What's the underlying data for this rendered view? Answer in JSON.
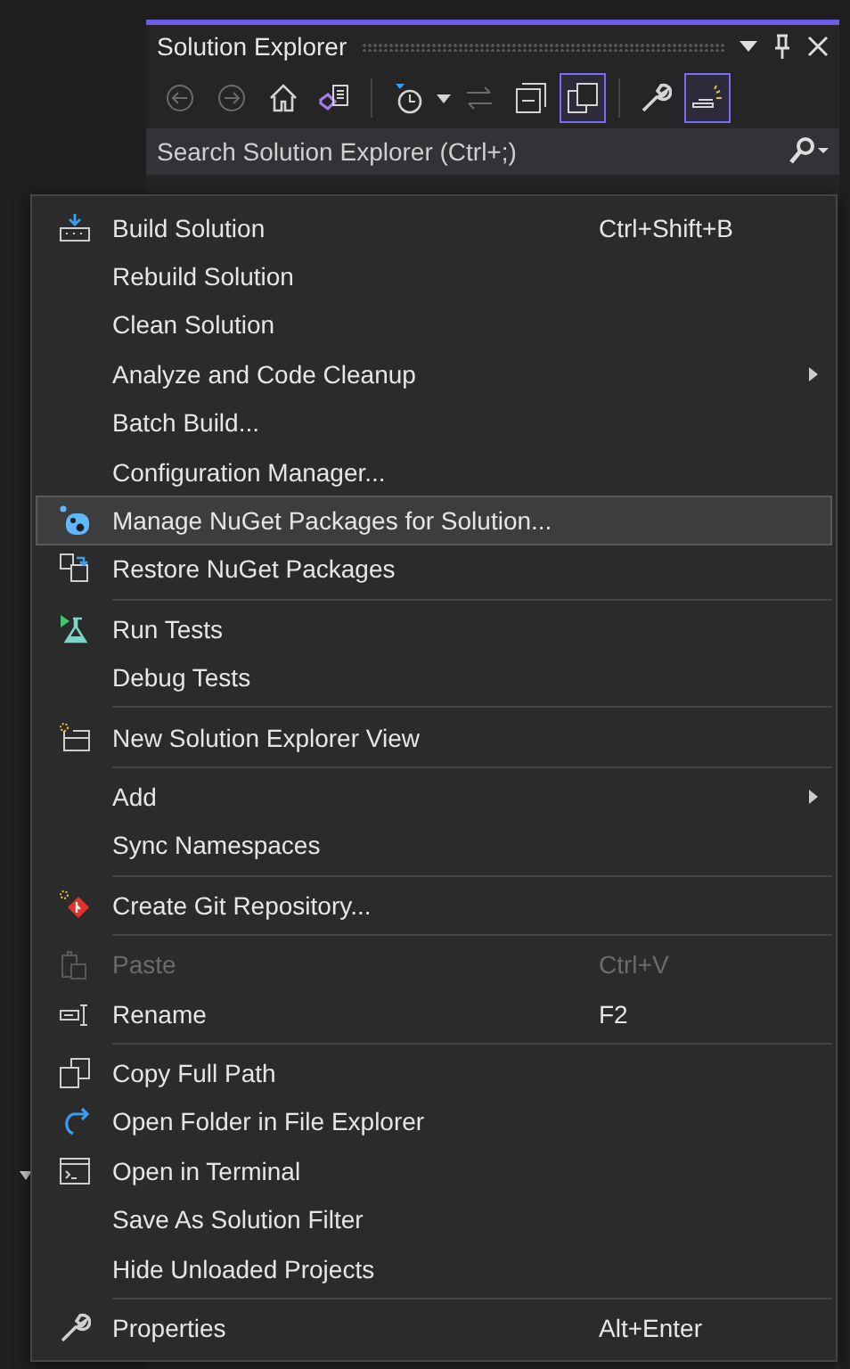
{
  "panel": {
    "title": "Solution Explorer",
    "search": {
      "placeholder": "Search Solution Explorer (Ctrl+;)"
    },
    "toolbar": [
      {
        "kind": "button",
        "disabled": true,
        "selected": false
      },
      {
        "kind": "button",
        "disabled": true,
        "selected": false
      },
      {
        "kind": "button",
        "disabled": false,
        "selected": false
      },
      {
        "kind": "button",
        "disabled": false,
        "selected": false
      },
      {
        "kind": "divider"
      },
      {
        "kind": "button",
        "disabled": false,
        "selected": false
      },
      {
        "kind": "dropdown"
      },
      {
        "kind": "button",
        "disabled": true,
        "selected": false
      },
      {
        "kind": "button",
        "disabled": false,
        "selected": false
      },
      {
        "kind": "button",
        "disabled": false,
        "selected": true
      },
      {
        "kind": "divider"
      },
      {
        "kind": "button",
        "disabled": false,
        "selected": false
      },
      {
        "kind": "button",
        "disabled": false,
        "selected": true
      }
    ]
  },
  "menu": [
    {
      "kind": "item",
      "label": "Build Solution",
      "shortcut": "Ctrl+Shift+B",
      "disabled": false,
      "selected": false,
      "submenu": false
    },
    {
      "kind": "item",
      "label": "Rebuild Solution",
      "disabled": false,
      "selected": false,
      "submenu": false
    },
    {
      "kind": "item",
      "label": "Clean Solution",
      "disabled": false,
      "selected": false,
      "submenu": false
    },
    {
      "kind": "item",
      "label": "Analyze and Code Cleanup",
      "disabled": false,
      "selected": false,
      "submenu": true
    },
    {
      "kind": "item",
      "label": "Batch Build...",
      "disabled": false,
      "selected": false,
      "submenu": false
    },
    {
      "kind": "item",
      "label": "Configuration Manager...",
      "disabled": false,
      "selected": false,
      "submenu": false
    },
    {
      "kind": "item",
      "label": "Manage NuGet Packages for Solution...",
      "disabled": false,
      "selected": true,
      "submenu": false
    },
    {
      "kind": "item",
      "label": "Restore NuGet Packages",
      "disabled": false,
      "selected": false,
      "submenu": false
    },
    {
      "kind": "separator"
    },
    {
      "kind": "item",
      "label": "Run Tests",
      "disabled": false,
      "selected": false,
      "submenu": false
    },
    {
      "kind": "item",
      "label": "Debug Tests",
      "disabled": false,
      "selected": false,
      "submenu": false
    },
    {
      "kind": "separator"
    },
    {
      "kind": "item",
      "label": "New Solution Explorer View",
      "disabled": false,
      "selected": false,
      "submenu": false
    },
    {
      "kind": "separator"
    },
    {
      "kind": "item",
      "label": "Add",
      "disabled": false,
      "selected": false,
      "submenu": true
    },
    {
      "kind": "item",
      "label": "Sync Namespaces",
      "disabled": false,
      "selected": false,
      "submenu": false
    },
    {
      "kind": "separator"
    },
    {
      "kind": "item",
      "label": "Create Git Repository...",
      "disabled": false,
      "selected": false,
      "submenu": false
    },
    {
      "kind": "separator"
    },
    {
      "kind": "item",
      "label": "Paste",
      "shortcut": "Ctrl+V",
      "disabled": true,
      "selected": false,
      "submenu": false
    },
    {
      "kind": "item",
      "label": "Rename",
      "shortcut": "F2",
      "disabled": false,
      "selected": false,
      "submenu": false
    },
    {
      "kind": "separator"
    },
    {
      "kind": "item",
      "label": "Copy Full Path",
      "disabled": false,
      "selected": false,
      "submenu": false
    },
    {
      "kind": "item",
      "label": "Open Folder in File Explorer",
      "disabled": false,
      "selected": false,
      "submenu": false
    },
    {
      "kind": "item",
      "label": "Open in Terminal",
      "disabled": false,
      "selected": false,
      "submenu": false
    },
    {
      "kind": "item",
      "label": "Save As Solution Filter",
      "disabled": false,
      "selected": false,
      "submenu": false
    },
    {
      "kind": "item",
      "label": "Hide Unloaded Projects",
      "disabled": false,
      "selected": false,
      "submenu": false
    },
    {
      "kind": "separator"
    },
    {
      "kind": "item",
      "label": "Properties",
      "shortcut": "Alt+Enter",
      "disabled": false,
      "selected": false,
      "submenu": false
    }
  ]
}
